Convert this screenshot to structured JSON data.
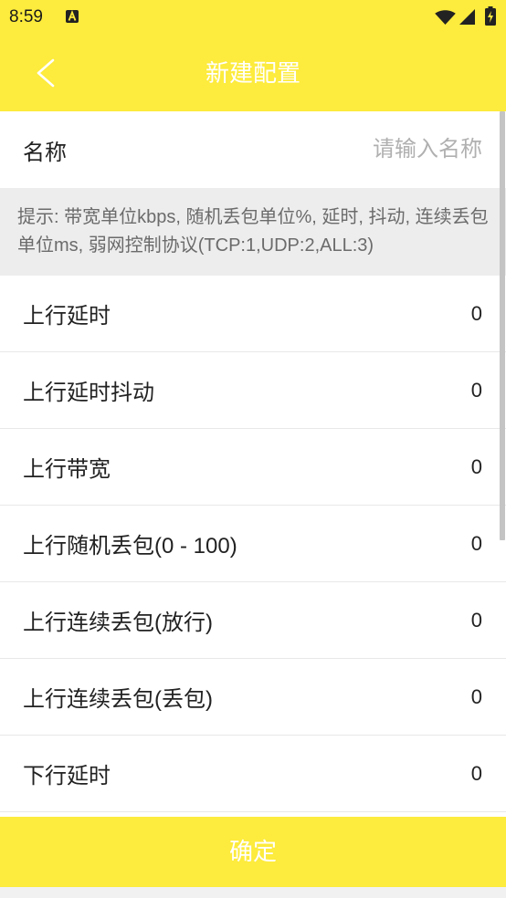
{
  "status_bar": {
    "time": "8:59",
    "icons": [
      "notification-a-icon",
      "wifi-icon",
      "signal-icon",
      "battery-icon"
    ]
  },
  "header": {
    "back_icon": "chevron-left-icon",
    "title": "新建配置"
  },
  "form": {
    "name": {
      "label": "名称",
      "placeholder": "请输入名称"
    },
    "hint": "提示: 带宽单位kbps, 随机丢包单位%, 延时, 抖动, 连续丢包单位ms, 弱网控制协议(TCP:1,UDP:2,ALL:3)",
    "rows": [
      {
        "label": "上行延时",
        "value": "0"
      },
      {
        "label": "上行延时抖动",
        "value": "0"
      },
      {
        "label": "上行带宽",
        "value": "0"
      },
      {
        "label": "上行随机丢包(0 - 100)",
        "value": "0"
      },
      {
        "label": "上行连续丢包(放行)",
        "value": "0"
      },
      {
        "label": "上行连续丢包(丢包)",
        "value": "0"
      },
      {
        "label": "下行延时",
        "value": "0"
      }
    ]
  },
  "footer": {
    "confirm_label": "确定"
  },
  "colors": {
    "accent": "#FDEB3D",
    "text": "#222222",
    "placeholder": "#B0B0B0",
    "hint_bg": "#EDEDED",
    "hint_text": "#6B6B6B"
  }
}
